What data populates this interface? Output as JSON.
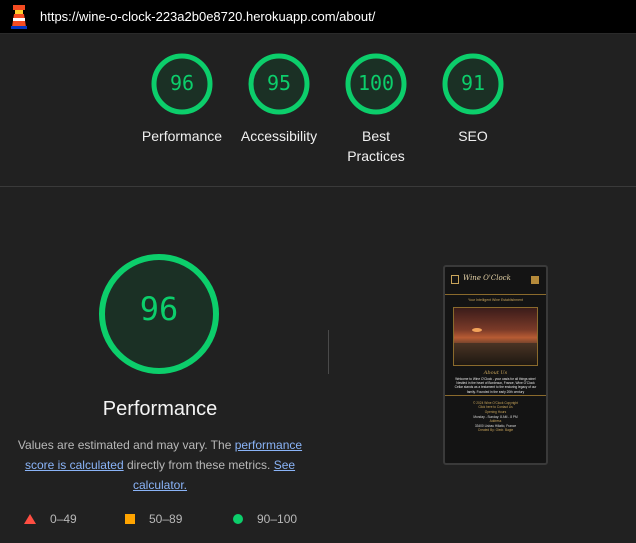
{
  "browser": {
    "url": "https://wine-o-clock-223a2b0e8720.herokuapp.com/about/"
  },
  "colors": {
    "pass": "#0cce6b",
    "average": "#ffa400",
    "fail": "#ff4e42",
    "link": "#8ab4f8"
  },
  "gauges": [
    {
      "label": "Performance",
      "score": 96
    },
    {
      "label": "Accessibility",
      "score": 95
    },
    {
      "label": "Best Practices",
      "score": 100
    },
    {
      "label": "SEO",
      "score": 91
    }
  ],
  "main": {
    "score": 96,
    "title": "Performance",
    "desc_prefix": "Values are estimated and may vary. The ",
    "desc_link1": "performance score is calculated",
    "desc_mid": " directly from these metrics. ",
    "desc_link2": "See calculator."
  },
  "legend": [
    {
      "range": "0–49",
      "icon": "triangle-icon"
    },
    {
      "range": "50–89",
      "icon": "square-icon"
    },
    {
      "range": "90–100",
      "icon": "circle-icon"
    }
  ],
  "screenshot": {
    "brand": "Wine O'Clock",
    "tagline": "Your Intelligent Wine Establishment",
    "about_title": "About Us",
    "about_text": "Welcome to Wine O'Clock - your oasis for all things wine! Nestled in the heart of Bordeaux, France, Wine O'Clock Cellar stands as a testament to the enduring legacy of our family. Founded in the early 20th century",
    "copyright": "© 2024 Wine O'Clock Copyright",
    "contact": "Click here to Contact Us",
    "hours_title": "Opening Hours",
    "hours": "Monday - Sunday: 8 AM - 8 PM",
    "address_title": "Address",
    "address": "33400 Lisbau Hiliatio, France",
    "credit": "Created By: Giedr. Bagie"
  }
}
